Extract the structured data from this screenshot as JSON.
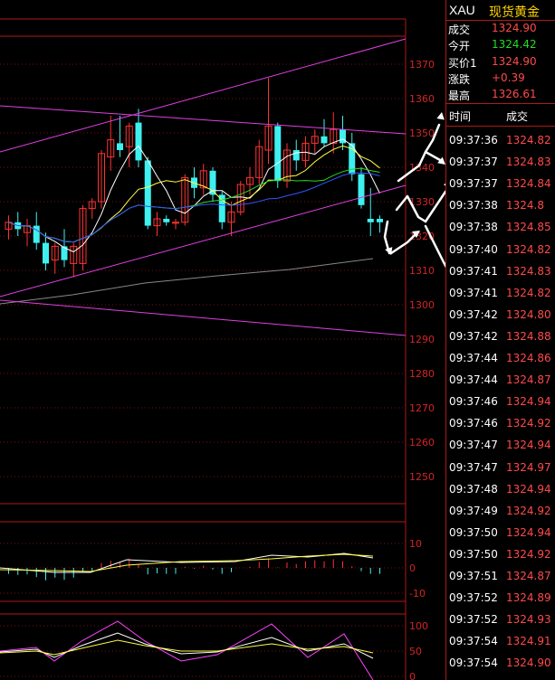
{
  "chart": {
    "price_axis": [
      "1370",
      "1360",
      "1350",
      "1340",
      "1330",
      "1320",
      "1310",
      "1300",
      "1290",
      "1280",
      "1270",
      "1260",
      "1250"
    ],
    "macd_axis": [
      "10",
      "0",
      "-10"
    ],
    "kdj_axis": [
      "100",
      "50",
      "0"
    ],
    "colors": {
      "up_candle": "#ff3232",
      "down_candle": "#3ff0f0",
      "channel_line": "#e040e0",
      "ma5": "#ffffff",
      "ma10": "#ffff44",
      "ma20": "#ff44ff",
      "ma30": "#22dd22",
      "ma60": "#3355ff",
      "ma120": "#888888",
      "grid": "#7a0f0f",
      "axis_text": "#d42424",
      "annotation": "#ffffff"
    },
    "chart_data": {
      "type": "candlestick",
      "title": "",
      "ylim": [
        1245,
        1378
      ],
      "candles": [
        {
          "o": 1322,
          "h": 1326,
          "l": 1319,
          "c": 1324
        },
        {
          "o": 1324,
          "h": 1327,
          "l": 1320,
          "c": 1322
        },
        {
          "o": 1321,
          "h": 1325,
          "l": 1317,
          "c": 1323
        },
        {
          "o": 1323,
          "h": 1327,
          "l": 1316,
          "c": 1318
        },
        {
          "o": 1318,
          "h": 1321,
          "l": 1310,
          "c": 1312
        },
        {
          "o": 1313,
          "h": 1318,
          "l": 1309,
          "c": 1317
        },
        {
          "o": 1317,
          "h": 1322,
          "l": 1311,
          "c": 1313
        },
        {
          "o": 1312,
          "h": 1318,
          "l": 1308,
          "c": 1317
        },
        {
          "o": 1312,
          "h": 1329,
          "l": 1310,
          "c": 1328
        },
        {
          "o": 1328,
          "h": 1331,
          "l": 1325,
          "c": 1330
        },
        {
          "o": 1330,
          "h": 1345,
          "l": 1328,
          "c": 1344
        },
        {
          "o": 1343,
          "h": 1355,
          "l": 1339,
          "c": 1348
        },
        {
          "o": 1347,
          "h": 1355,
          "l": 1343,
          "c": 1345
        },
        {
          "o": 1346,
          "h": 1353,
          "l": 1340,
          "c": 1352
        },
        {
          "o": 1353,
          "h": 1357,
          "l": 1340,
          "c": 1342
        },
        {
          "o": 1342,
          "h": 1343,
          "l": 1322,
          "c": 1323
        },
        {
          "o": 1323,
          "h": 1327,
          "l": 1320,
          "c": 1325
        },
        {
          "o": 1325,
          "h": 1326,
          "l": 1323,
          "c": 1324
        },
        {
          "o": 1324,
          "h": 1325,
          "l": 1322,
          "c": 1324
        },
        {
          "o": 1324,
          "h": 1338,
          "l": 1323,
          "c": 1337
        },
        {
          "o": 1337,
          "h": 1340,
          "l": 1331,
          "c": 1334
        },
        {
          "o": 1334,
          "h": 1341,
          "l": 1332,
          "c": 1339
        },
        {
          "o": 1339,
          "h": 1340,
          "l": 1330,
          "c": 1332
        },
        {
          "o": 1332,
          "h": 1333,
          "l": 1322,
          "c": 1324
        },
        {
          "o": 1324,
          "h": 1330,
          "l": 1320,
          "c": 1327
        },
        {
          "o": 1327,
          "h": 1336,
          "l": 1326,
          "c": 1335
        },
        {
          "o": 1335,
          "h": 1340,
          "l": 1332,
          "c": 1337
        },
        {
          "o": 1337,
          "h": 1348,
          "l": 1335,
          "c": 1346
        },
        {
          "o": 1345,
          "h": 1366,
          "l": 1341,
          "c": 1352
        },
        {
          "o": 1352,
          "h": 1353,
          "l": 1334,
          "c": 1336
        },
        {
          "o": 1336,
          "h": 1347,
          "l": 1334,
          "c": 1345
        },
        {
          "o": 1345,
          "h": 1348,
          "l": 1339,
          "c": 1342
        },
        {
          "o": 1342,
          "h": 1349,
          "l": 1340,
          "c": 1347
        },
        {
          "o": 1347,
          "h": 1351,
          "l": 1344,
          "c": 1349
        },
        {
          "o": 1349,
          "h": 1354,
          "l": 1346,
          "c": 1347
        },
        {
          "o": 1347,
          "h": 1356,
          "l": 1344,
          "c": 1351
        },
        {
          "o": 1351,
          "h": 1355,
          "l": 1345,
          "c": 1347
        },
        {
          "o": 1347,
          "h": 1350,
          "l": 1336,
          "c": 1338
        },
        {
          "o": 1338,
          "h": 1340,
          "l": 1328,
          "c": 1329
        },
        {
          "o": 1325,
          "h": 1334,
          "l": 1320,
          "c": 1324
        },
        {
          "o": 1325,
          "h": 1326,
          "l": 1321,
          "c": 1324
        }
      ]
    }
  },
  "quote": {
    "symbol": "XAU",
    "name": "现货黄金",
    "rows": [
      {
        "label": "成交",
        "value": "1324.90",
        "color": "red"
      },
      {
        "label": "今开",
        "value": "1324.42",
        "color": "green"
      },
      {
        "label": "买价1",
        "value": "1324.90",
        "color": "red"
      },
      {
        "label": "涨跌",
        "value": "+0.39",
        "color": "red"
      },
      {
        "label": "最高",
        "value": "1326.61",
        "color": "red"
      }
    ]
  },
  "trades": {
    "header_time": "时间",
    "header_price": "成交",
    "rows": [
      {
        "time": "09:37:36",
        "price": "1324.82"
      },
      {
        "time": "09:37:37",
        "price": "1324.83"
      },
      {
        "time": "09:37:37",
        "price": "1324.84"
      },
      {
        "time": "09:37:38",
        "price": "1324.8"
      },
      {
        "time": "09:37:38",
        "price": "1324.85"
      },
      {
        "time": "09:37:40",
        "price": "1324.82"
      },
      {
        "time": "09:37:41",
        "price": "1324.83"
      },
      {
        "time": "09:37:41",
        "price": "1324.82"
      },
      {
        "time": "09:37:42",
        "price": "1324.80"
      },
      {
        "time": "09:37:42",
        "price": "1324.88"
      },
      {
        "time": "09:37:44",
        "price": "1324.86"
      },
      {
        "time": "09:37:44",
        "price": "1324.87"
      },
      {
        "time": "09:37:46",
        "price": "1324.94"
      },
      {
        "time": "09:37:46",
        "price": "1324.92"
      },
      {
        "time": "09:37:47",
        "price": "1324.94"
      },
      {
        "time": "09:37:47",
        "price": "1324.97"
      },
      {
        "time": "09:37:48",
        "price": "1324.94"
      },
      {
        "time": "09:37:49",
        "price": "1324.92"
      },
      {
        "time": "09:37:50",
        "price": "1324.94"
      },
      {
        "time": "09:37:50",
        "price": "1324.92"
      },
      {
        "time": "09:37:51",
        "price": "1324.87"
      },
      {
        "time": "09:37:52",
        "price": "1324.89"
      },
      {
        "time": "09:37:52",
        "price": "1324.93"
      },
      {
        "time": "09:37:54",
        "price": "1324.91"
      },
      {
        "time": "09:37:54",
        "price": "1324.90"
      }
    ]
  }
}
